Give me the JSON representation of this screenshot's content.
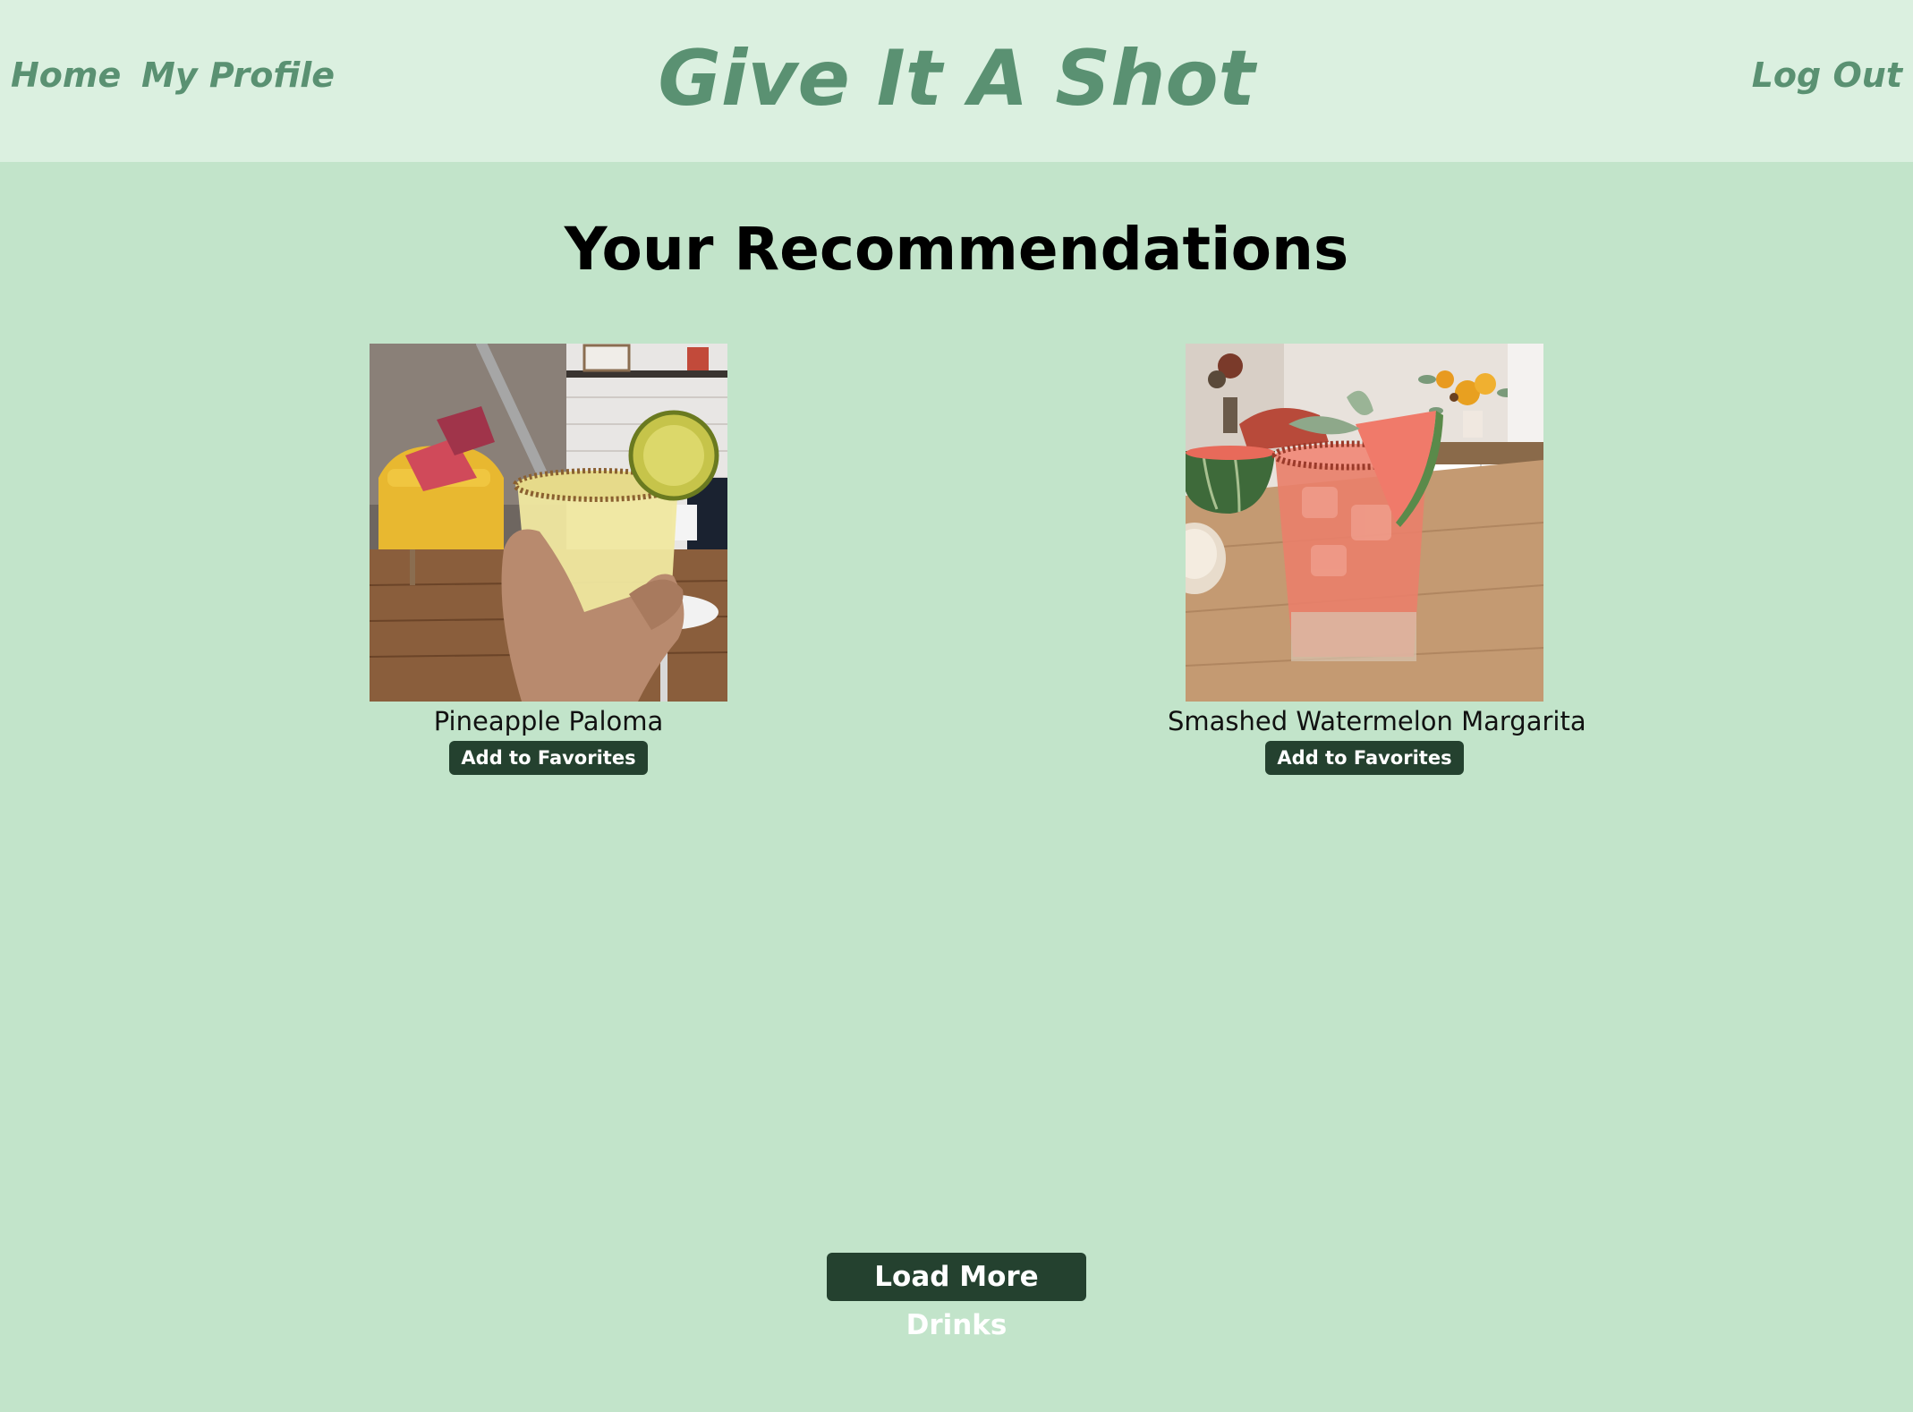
{
  "nav": {
    "home_label": "Home",
    "profile_label": "My Profile",
    "logout_label": "Log Out",
    "brand": "Give It A Shot"
  },
  "main": {
    "title": "Your Recommendations",
    "drinks": [
      {
        "name": "Pineapple Paloma",
        "button_label": "Add to Favorites"
      },
      {
        "name": "Smashed Watermelon Margarita",
        "button_label": "Add to Favorites"
      }
    ],
    "load_more_label": "Load More Drinks"
  },
  "colors": {
    "page_bg": "#c2e4ca",
    "nav_bg": "#dbf0e0",
    "accent_text": "#5a9172",
    "button_bg": "#24412f"
  }
}
